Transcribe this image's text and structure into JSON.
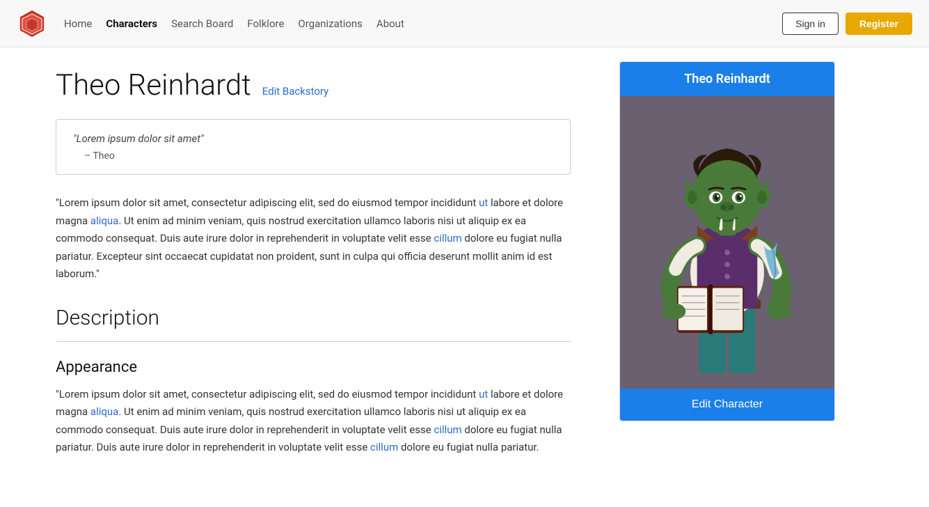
{
  "nav": {
    "links": [
      {
        "label": "Home",
        "active": false
      },
      {
        "label": "Characters",
        "active": true
      },
      {
        "label": "Search Board",
        "active": false
      },
      {
        "label": "Folklore",
        "active": false
      },
      {
        "label": "Organizations",
        "active": false
      },
      {
        "label": "About",
        "active": false
      }
    ],
    "signin_label": "Sign in",
    "register_label": "Register"
  },
  "character": {
    "name": "Theo Reinhardt",
    "edit_backstory_label": "Edit Backstory",
    "quote_text": "\"Lorem ipsum dolor sit amet\"",
    "quote_attr": "– Theo",
    "body_text": "\"Lorem ipsum dolor sit amet, consectetur adipiscing elit, sed do eiusmod tempor incididunt ut labore et dolore magna aliqua. Ut enim ad minim veniam, quis nostrud exercitation ullamco laboris nisi ut aliquip ex ea commodo consequat. Duis aute irure dolor in reprehenderit in voluptate velit esse cillum dolore eu fugiat nulla pariatur. Excepteur sint occaecat cupidatat non proident, sunt in culpa qui officia deserunt mollit anim id est laborum.\"",
    "description_label": "Description",
    "appearance_label": "Appearance",
    "appearance_text": "\"Lorem ipsum dolor sit amet, consectetur adipiscing elit, sed do eiusmod tempor incididunt ut labore et dolore magna aliqua. Ut enim ad minim veniam, quis nostrud exercitation ullamco laboris nisi ut aliquip ex ea commodo consequat. Duis aute irure dolor in reprehenderit in voluptate velit esse cillum dolore eu fugiat nulla pariatur. Duis aute irure dolor in reprehenderit in voluptate velit esse cillum dolore eu fugiat nulla pariatur."
  },
  "sidebar": {
    "card_name": "Theo Reinhardt",
    "edit_char_label": "Edit Character"
  },
  "colors": {
    "accent_blue": "#1a7fe8",
    "register_yellow": "#e8a800",
    "link_blue": "#2a6dc9",
    "card_bg": "#6b6070"
  }
}
